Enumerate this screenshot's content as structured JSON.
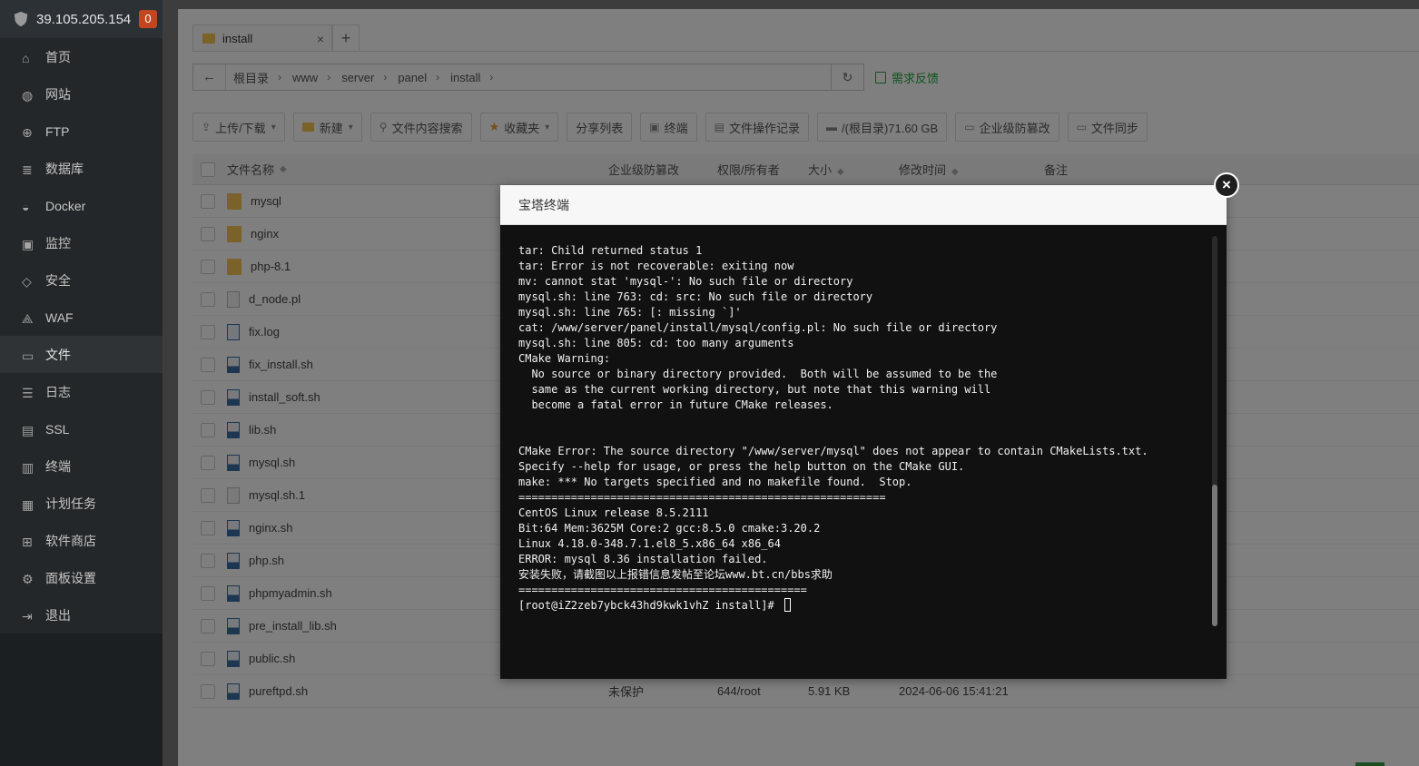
{
  "sidebar": {
    "ip": "39.105.205.154",
    "badge": "0",
    "items": [
      {
        "label": "首页",
        "icon": "home-icon"
      },
      {
        "label": "网站",
        "icon": "globe-icon"
      },
      {
        "label": "FTP",
        "icon": "ftp-icon"
      },
      {
        "label": "数据库",
        "icon": "database-icon"
      },
      {
        "label": "Docker",
        "icon": "docker-icon"
      },
      {
        "label": "监控",
        "icon": "monitor-icon"
      },
      {
        "label": "安全",
        "icon": "shield-icon"
      },
      {
        "label": "WAF",
        "icon": "waf-icon"
      },
      {
        "label": "文件",
        "icon": "folder-icon"
      },
      {
        "label": "日志",
        "icon": "log-icon"
      },
      {
        "label": "SSL",
        "icon": "ssl-icon"
      },
      {
        "label": "终端",
        "icon": "terminal-icon"
      },
      {
        "label": "计划任务",
        "icon": "schedule-icon"
      },
      {
        "label": "软件商店",
        "icon": "store-icon"
      },
      {
        "label": "面板设置",
        "icon": "gear-icon"
      },
      {
        "label": "退出",
        "icon": "logout-icon"
      }
    ]
  },
  "tab": {
    "label": "install",
    "close": "×",
    "add": "+"
  },
  "path": {
    "crumbs": [
      "根目录",
      "www",
      "server",
      "panel",
      "install"
    ],
    "feedback": "需求反馈"
  },
  "toolbar": {
    "upload": "上传/下载",
    "new": "新建",
    "search": "文件内容搜索",
    "favorites": "收藏夹",
    "share": "分享列表",
    "terminal": "终端",
    "oplog": "文件操作记录",
    "disk": "/(根目录)71.60 GB",
    "tamper": "企业级防篡改",
    "sync": "文件同步"
  },
  "table": {
    "headers": {
      "name": "文件名称",
      "protect": "企业级防篡改",
      "perm": "权限/所有者",
      "size": "大小",
      "mtime": "修改时间",
      "note": "备注"
    },
    "rows": [
      {
        "name": "mysql",
        "type": "folder"
      },
      {
        "name": "nginx",
        "type": "folder"
      },
      {
        "name": "php-8.1",
        "type": "folder"
      },
      {
        "name": "d_node.pl",
        "type": "file"
      },
      {
        "name": "fix.log",
        "type": "log"
      },
      {
        "name": "fix_install.sh",
        "type": "sh"
      },
      {
        "name": "install_soft.sh",
        "type": "sh"
      },
      {
        "name": "lib.sh",
        "type": "sh"
      },
      {
        "name": "mysql.sh",
        "type": "sh"
      },
      {
        "name": "mysql.sh.1",
        "type": "file"
      },
      {
        "name": "nginx.sh",
        "type": "sh"
      },
      {
        "name": "php.sh",
        "type": "sh"
      },
      {
        "name": "phpmyadmin.sh",
        "type": "sh"
      },
      {
        "name": "pre_install_lib.sh",
        "type": "sh"
      },
      {
        "name": "public.sh",
        "type": "sh"
      },
      {
        "name": "pureftpd.sh",
        "type": "sh",
        "protect": "未保护",
        "perm": "644/root",
        "size": "5.91 KB",
        "mtime": "2024-06-06 15:41:21"
      }
    ]
  },
  "modal": {
    "title": "宝塔终端",
    "close": "×",
    "lines": [
      "tar: Child returned status 1",
      "tar: Error is not recoverable: exiting now",
      "mv: cannot stat 'mysql-': No such file or directory",
      "mysql.sh: line 763: cd: src: No such file or directory",
      "mysql.sh: line 765: [: missing `]'",
      "cat: /www/server/panel/install/mysql/config.pl: No such file or directory",
      "mysql.sh: line 805: cd: too many arguments",
      "CMake Warning:",
      "  No source or binary directory provided.  Both will be assumed to be the",
      "  same as the current working directory, but note that this warning will",
      "  become a fatal error in future CMake releases.",
      "",
      "",
      "CMake Error: The source directory \"/www/server/mysql\" does not appear to contain CMakeLists.txt.",
      "Specify --help for usage, or press the help button on the CMake GUI.",
      "make: *** No targets specified and no makefile found.  Stop.",
      "========================================================",
      "CentOS Linux release 8.5.2111",
      "Bit:64 Mem:3625M Core:2 gcc:8.5.0 cmake:3.20.2",
      "Linux 4.18.0-348.7.1.el8_5.x86_64 x86_64",
      "ERROR: mysql 8.36 installation failed.",
      "安装失败，请截图以上报错信息发帖至论坛www.bt.cn/bbs求助",
      "============================================",
      "[root@iZ2zeb7ybck43hd9kwk1vhZ install]# "
    ]
  }
}
